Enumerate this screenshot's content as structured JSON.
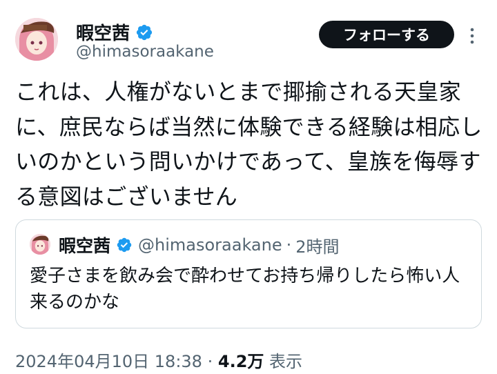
{
  "author": {
    "name": "暇空茜",
    "handle": "@himasoraakane"
  },
  "follow_label": "フォローする",
  "tweet_text": "これは、人権がないとまで揶揄される天皇家に、庶民ならば当然に体験できる経験は相応しいのかという問いかけであって、皇族を侮辱する意図はございません",
  "quoted_tweet": {
    "name": "暇空茜",
    "handle": "@himasoraakane",
    "separator": "·",
    "time": "2時間",
    "text": "愛子さまを飲み会で酔わせてお持ち帰りしたら怖い人来るのかな"
  },
  "meta": {
    "timestamp": "2024年04月10日 18:38",
    "separator": "·",
    "views_count": "4.2万",
    "views_label": "表示"
  },
  "icons": {
    "verified": "verified-badge-icon",
    "more": "more-dots-icon"
  },
  "colors": {
    "verified_blue": "#1d9bf0",
    "follow_bg": "#0f1419",
    "secondary_text": "#536471",
    "border": "#cfd9de"
  }
}
